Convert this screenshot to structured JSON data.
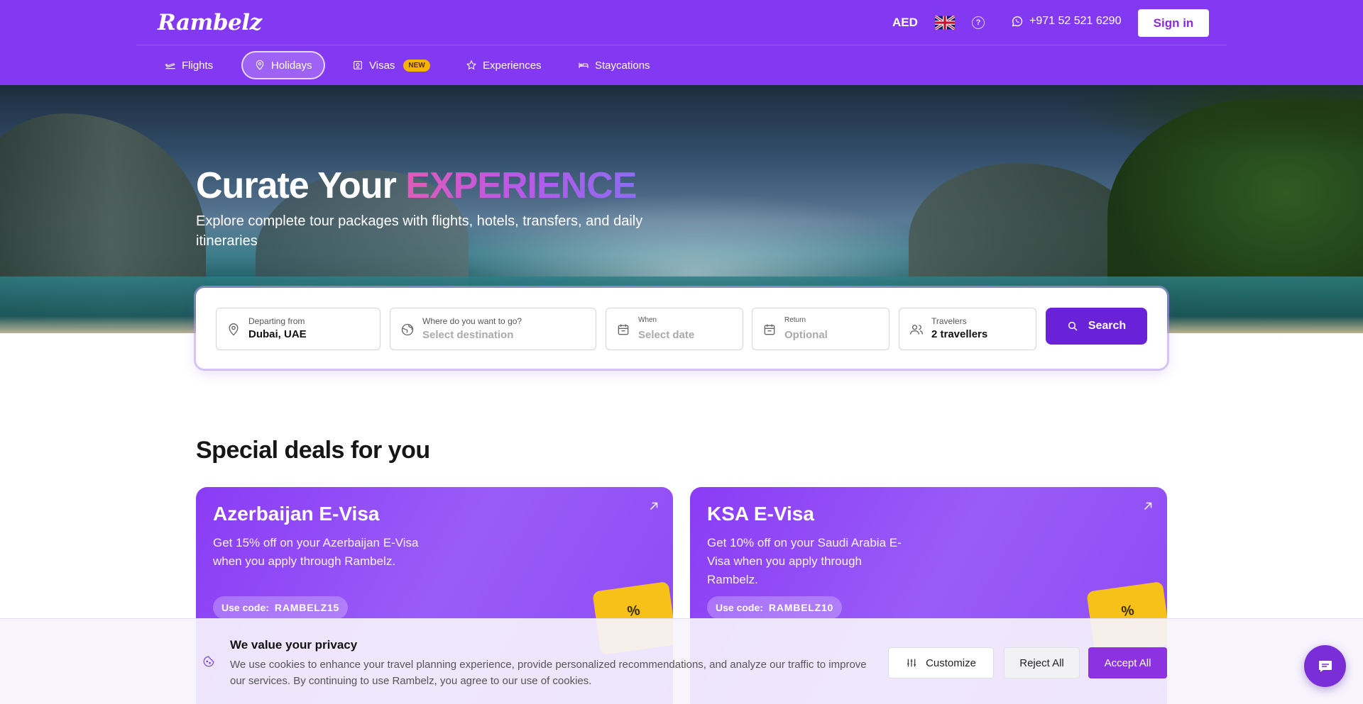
{
  "header": {
    "logo": "Rambelz",
    "currency": "AED",
    "phone": "+971 52 521 6290",
    "sign_in": "Sign in",
    "help_symbol": "?",
    "brand_color": "#8338f2"
  },
  "nav": {
    "items": [
      {
        "label": "Flights",
        "icon": "plane-icon"
      },
      {
        "label": "Holidays",
        "icon": "map-pin-icon",
        "active": true
      },
      {
        "label": "Visas",
        "icon": "passport-icon",
        "badge": "NEW"
      },
      {
        "label": "Experiences",
        "icon": "star-icon"
      },
      {
        "label": "Staycations",
        "icon": "bed-icon"
      }
    ]
  },
  "hero": {
    "title_prefix": "Curate Your",
    "title_accent": "EXPERIENCE",
    "subtitle": "Explore complete tour packages with flights, hotels, transfers, and daily itineraries"
  },
  "search": {
    "departing_label": "Departing from",
    "departing_value": "Dubai, UAE",
    "destination_label": "Where do you want to go?",
    "destination_placeholder": "Select destination",
    "when_label": "When",
    "when_placeholder": "Select date",
    "return_label": "Return",
    "return_placeholder": "Optional",
    "travelers_label": "Travelers",
    "travelers_value": "2 travellers",
    "button": "Search"
  },
  "deals": {
    "title": "Special deals for you",
    "items": [
      {
        "title": "Azerbaijan E-Visa",
        "description": "Get 15% off on your Azerbaijan E-Visa when you apply through Rambelz.",
        "code_label": "Use code:",
        "code": "RAMBELZ15",
        "tag": "%"
      },
      {
        "title": "KSA E-Visa",
        "description": "Get 10% off on your Saudi Arabia E-Visa when you apply through Rambelz.",
        "code_label": "Use code:",
        "code": "RAMBELZ10",
        "tag": "%"
      }
    ]
  },
  "cookie": {
    "title": "We value your privacy",
    "text": "We use cookies to enhance your travel planning experience, provide personalized recommendations, and analyze our traffic to improve our services. By continuing to use Rambelz, you agree to our use of cookies.",
    "customize": "Customize",
    "reject": "Reject All",
    "accept": "Accept All"
  }
}
